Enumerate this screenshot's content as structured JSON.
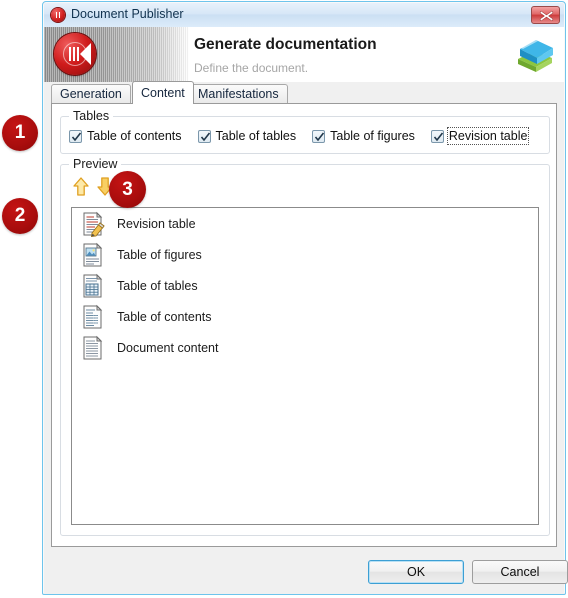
{
  "window": {
    "title": "Document Publisher",
    "title_icon": "app-record-icon",
    "close_label": "x"
  },
  "header": {
    "title": "Generate documentation",
    "subtitle": "Define the document.",
    "logo_icon": "media-publisher-icon",
    "side_icon": "books-icon"
  },
  "tabs": [
    {
      "id": "generation",
      "label": "Generation",
      "active": false
    },
    {
      "id": "content",
      "label": "Content",
      "active": true
    },
    {
      "id": "manifestations",
      "label": "Manifestations",
      "active": false
    }
  ],
  "tables_group": {
    "label": "Tables",
    "checkboxes": [
      {
        "label": "Table of contents",
        "checked": true,
        "focused": false
      },
      {
        "label": "Table of tables",
        "checked": true,
        "focused": false
      },
      {
        "label": "Table of figures",
        "checked": true,
        "focused": false
      },
      {
        "label": "Revision table",
        "checked": true,
        "focused": true
      }
    ]
  },
  "preview_group": {
    "label": "Preview",
    "move_up_icon": "arrow-up-icon",
    "move_down_icon": "arrow-down-icon",
    "items": [
      {
        "label": "Revision table",
        "icon": "document-pencil-icon"
      },
      {
        "label": "Table of figures",
        "icon": "document-image-icon"
      },
      {
        "label": "Table of tables",
        "icon": "document-grid-icon"
      },
      {
        "label": "Table of contents",
        "icon": "document-list-icon"
      },
      {
        "label": "Document content",
        "icon": "document-text-icon"
      }
    ]
  },
  "footer": {
    "ok_label": "OK",
    "cancel_label": "Cancel"
  },
  "annotations": [
    {
      "id": "badge-1",
      "number": "1"
    },
    {
      "id": "badge-2",
      "number": "2"
    },
    {
      "id": "badge-3",
      "number": "3"
    }
  ],
  "colors": {
    "badge_red": "#a80d0d",
    "accent_blue": "#3c9fd4",
    "arrow_gold": "#f0c040",
    "close_red": "#cc3a3a"
  }
}
